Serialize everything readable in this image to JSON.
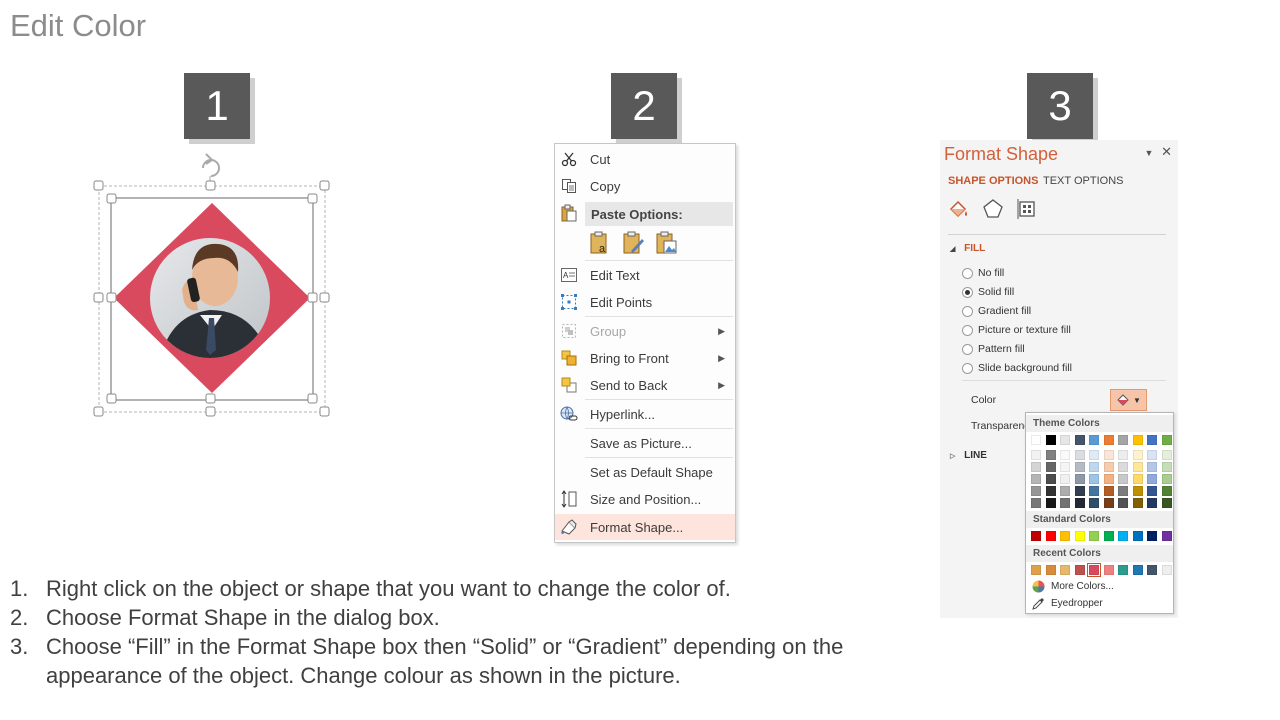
{
  "title": "Edit Color",
  "steps": [
    {
      "num": "1",
      "label": "1."
    },
    {
      "num": "2",
      "label": "2."
    },
    {
      "num": "3",
      "label": "3."
    }
  ],
  "instructions": [
    "Right click on the object or shape that you want to change the color of.",
    "Choose Format Shape in the dialog box.",
    "Choose “Fill” in the Format Shape box then “Solid” or “Gradient” depending on the appearance of the object. Change colour as shown in the picture."
  ],
  "shape": {
    "fill_color": "#d94a5f"
  },
  "context_menu": {
    "cut": "Cut",
    "copy": "Copy",
    "paste_options": "Paste Options:",
    "edit_text": "Edit Text",
    "edit_points": "Edit Points",
    "group": "Group",
    "bring_to_front": "Bring to Front",
    "send_to_back": "Send to Back",
    "hyperlink": "Hyperlink...",
    "save_as_picture": "Save as Picture...",
    "set_default_shape": "Set as Default Shape",
    "size_and_position": "Size and Position...",
    "format_shape": "Format Shape..."
  },
  "format_pane": {
    "title": "Format Shape",
    "tab_shape": "SHAPE OPTIONS",
    "tab_text": "TEXT OPTIONS",
    "fill_section": "FILL",
    "line_section": "LINE",
    "fill_options": [
      "No fill",
      "Solid fill",
      "Gradient fill",
      "Picture or texture fill",
      "Pattern fill",
      "Slide background fill"
    ],
    "selected_fill": "Solid fill",
    "color_label": "Color",
    "transparency_label": "Transparenc"
  },
  "color_popup": {
    "theme_header": "Theme Colors",
    "standard_header": "Standard Colors",
    "recent_header": "Recent Colors",
    "more_colors": "More Colors...",
    "eyedropper": "Eyedropper",
    "theme_top": [
      "#ffffff",
      "#000000",
      "#e7e6e6",
      "#44546a",
      "#5b9bd5",
      "#ed7d31",
      "#a5a5a5",
      "#ffc000",
      "#4472c4",
      "#70ad47"
    ],
    "standard": [
      "#c00000",
      "#ff0000",
      "#ffc000",
      "#ffff00",
      "#92d050",
      "#00b050",
      "#00b0f0",
      "#0070c0",
      "#002060",
      "#7030a0"
    ],
    "recent": [
      "#e0a04a",
      "#d98b3a",
      "#e8b86a",
      "#c0504d",
      "#d94a5f",
      "#f08080",
      "#2a9d8f",
      "#1f77b4",
      "#44546a",
      "#eeeeee"
    ]
  }
}
